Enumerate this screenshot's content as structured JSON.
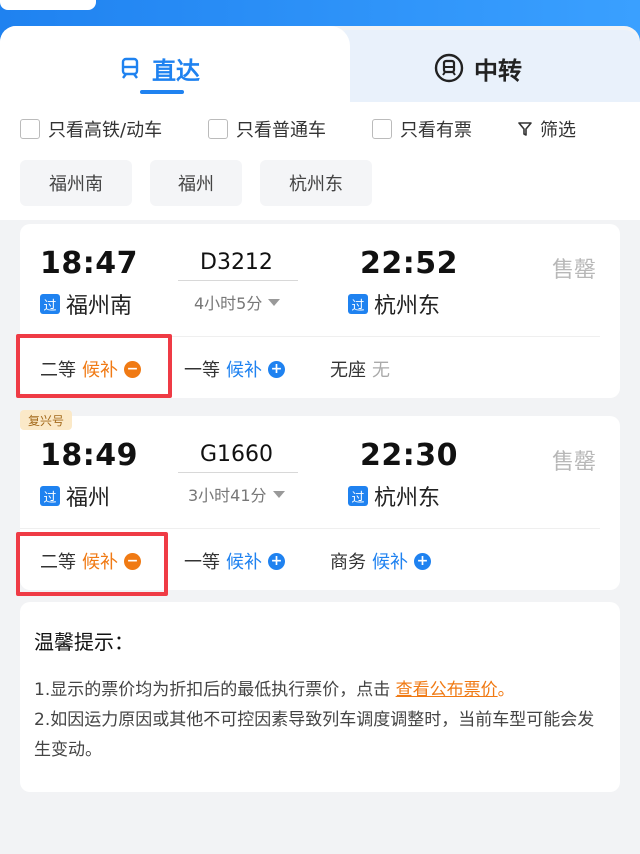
{
  "tabs": {
    "direct": "直达",
    "transfer": "中转"
  },
  "filters": [
    {
      "label": "只看高铁/动车"
    },
    {
      "label": "只看普通车"
    },
    {
      "label": "只看有票"
    },
    {
      "label": "筛选"
    }
  ],
  "stations": [
    "福州南",
    "福州",
    "杭州东"
  ],
  "trains": [
    {
      "depart_time": "18:47",
      "depart_station": "福州南",
      "train_no": "D3212",
      "duration": "4小时5分",
      "arrive_time": "22:52",
      "arrive_station": "杭州东",
      "status": "售罄",
      "badge": "",
      "seats": [
        {
          "class": "二等",
          "status": "候补",
          "kind": "orange"
        },
        {
          "class": "一等",
          "status": "候补",
          "kind": "blue"
        },
        {
          "class": "无座",
          "status": "无",
          "kind": "none"
        }
      ]
    },
    {
      "depart_time": "18:49",
      "depart_station": "福州",
      "train_no": "G1660",
      "duration": "3小时41分",
      "arrive_time": "22:30",
      "arrive_station": "杭州东",
      "status": "售罄",
      "badge": "复兴号",
      "seats": [
        {
          "class": "二等",
          "status": "候补",
          "kind": "orange"
        },
        {
          "class": "一等",
          "status": "候补",
          "kind": "blue"
        },
        {
          "class": "商务",
          "status": "候补",
          "kind": "blue"
        }
      ]
    }
  ],
  "pass_badge": "过",
  "tips": {
    "title": "温馨提示：",
    "line1_prefix": "1.显示的票价均为折扣后的最低执行票价，点击 ",
    "line1_link": "查看公布票价",
    "line1_suffix": "。",
    "line2": "2.如因运力原因或其他不可控因素导致列车调度调整时，当前车型可能会发生变动。"
  },
  "colors": {
    "accent": "#1f82f0",
    "waitlist": "#f07a14",
    "highlight": "#ef3b45"
  }
}
